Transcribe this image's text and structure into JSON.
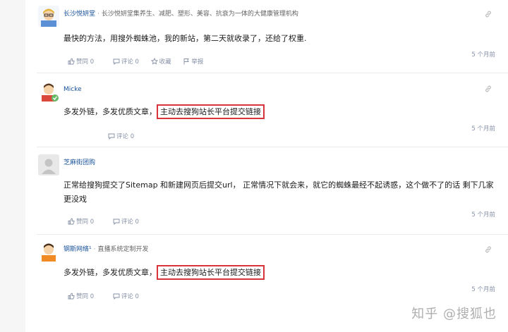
{
  "answers": [
    {
      "author": "长沙悦妍堂",
      "bio": "长沙悦妍堂集养生、减肥、塑形、美容、抗衰为一体的大健康管理机构",
      "content": "最快的方法，用搜外蜘蛛池，我的新站，第二天就收录了，还给了权重.",
      "time": "5 个月前",
      "upvote": "赞同 0",
      "comment": "评论 0",
      "favorite": "收藏",
      "report": "举报"
    },
    {
      "author": "Micke",
      "content_prefix": "多发外链，多发优质文章，",
      "content_highlight": "主动去搜狗站长平台提交链接",
      "time": "5 个月前",
      "comment": "评论 0"
    },
    {
      "author": "芝麻街团购",
      "content": "正常给搜狗提交了Sitemap 和新建网页后提交url， 正常情况下就会来，就它的蜘蛛最经不起诱惑，这个做不了的话 剩下几家更没戏",
      "time": "5 个月前",
      "upvote": "赞同 0",
      "comment": "评论 0"
    },
    {
      "author": "钢斯网络¹",
      "bio": "直播系统定制开发",
      "content_prefix": "多发外链，多发优质文章，",
      "content_highlight": "主动去搜狗站长平台提交链接",
      "time": "5 个月前",
      "upvote": "赞同 0",
      "comment": "评论 0"
    }
  ],
  "watermark": "知乎 @搜狐也",
  "colors": {
    "author_link": "#175199",
    "highlight_border": "#d8343c",
    "meta": "#8590a6"
  }
}
